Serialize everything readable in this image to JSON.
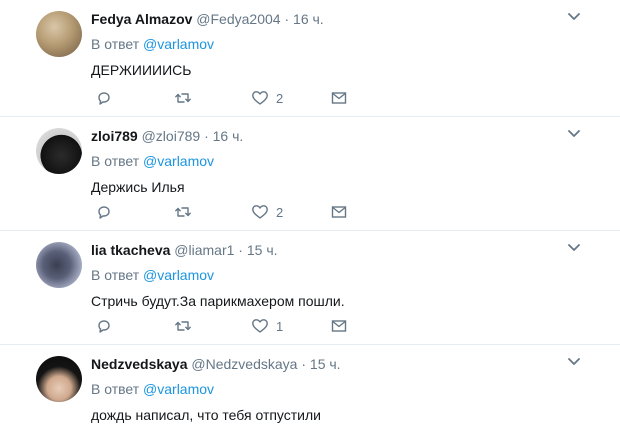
{
  "reply_prefix": "В ответ",
  "tweets": [
    {
      "name": "Fedya Almazov",
      "handle": "@Fedya2004",
      "separator": "·",
      "time": "16 ч.",
      "mention": "@varlamov",
      "text": "ДЕРЖИИИИСЬ",
      "likes": "2"
    },
    {
      "name": "zloi789",
      "handle": "@zloi789",
      "separator": "·",
      "time": "16 ч.",
      "mention": "@varlamov",
      "text": "Держись Илья",
      "likes": "2"
    },
    {
      "name": "lia tkacheva",
      "handle": "@liamar1",
      "separator": "·",
      "time": "15 ч.",
      "mention": "@varlamov",
      "text": "Стричь будут.За парикмахером пошли.",
      "likes": "1"
    },
    {
      "name": "Nedzvedskaya",
      "handle": "@Nedzvedskaya",
      "separator": "·",
      "time": "15 ч.",
      "mention": "@varlamov",
      "text": "дождь написал, что тебя отпустили"
    }
  ],
  "colors": {
    "name": "#14171a",
    "secondary": "#657786",
    "mention": "#1b95e0",
    "divider": "#e6ecf0"
  },
  "icons": [
    "reply-icon",
    "retweet-icon",
    "like-icon",
    "direct-message-icon",
    "chevron-down-icon"
  ]
}
